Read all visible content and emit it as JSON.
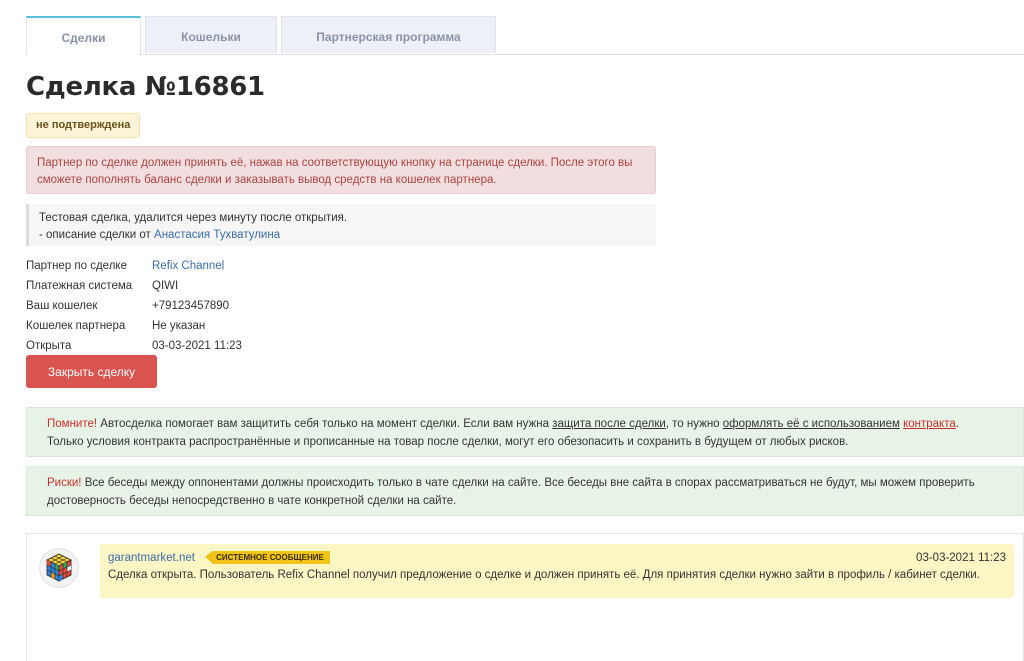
{
  "tabs": [
    {
      "label": "Сделки"
    },
    {
      "label": "Кошельки"
    },
    {
      "label": "Партнерская программа"
    }
  ],
  "deal": {
    "title": "Сделка №16861",
    "status": "не подтверждена"
  },
  "alert_partner": "Партнер по сделке должен принять её, нажав на соответствующую кнопку на странице сделки. После этого вы сможете пополнять баланс сделки и заказывать вывод средств на кошелек партнера.",
  "description": {
    "text": "Тестовая сделка, удалится через минуту после открытия.",
    "author_prefix": "- описание сделки от",
    "author": "Анастасия Тухватулина"
  },
  "info": [
    {
      "label": "Партнер по сделке",
      "value": "Refix Channel"
    },
    {
      "label": "Платежная система",
      "value": "QIWI"
    },
    {
      "label": "Ваш кошелек",
      "value": "+79123457890"
    },
    {
      "label": "Кошелек партнера",
      "value": "Не указан"
    },
    {
      "label": "Открыта",
      "value": "03-03-2021 11:23"
    }
  ],
  "close_button": "Закрыть сделку",
  "remember": {
    "lead": "Помните!",
    "t1": " Автосделка помогает вам защитить себя только на момент сделки. Если вам нужна ",
    "link1": "защита после сделки",
    "t2": ", то нужно ",
    "link2": "оформлять её с использованием",
    "t3": " ",
    "link3": "контракта",
    "t4": ".",
    "line2": "Только условия контракта распространённые и прописанные на товар после сделки, могут его обезопасить и сохранить в будущем от любых рисков."
  },
  "risks": {
    "lead": "Риски!",
    "text": " Все беседы между оппонентами должны происходить только в чате сделки на сайте. Все беседы вне сайта в спорах рассматриваться не будут, мы можем проверить достоверность беседы непосредственно в чате конкретной сделки на сайте."
  },
  "chat": {
    "sender": "garantmarket.net",
    "badge": "СИСТЕМНОЕ СООБЩЕНИЕ",
    "time": "03-03-2021 11:23",
    "text": "Сделка открыта. Пользователь Refix Channel получил предложение о сделке и должен принять её. Для принятия сделки нужно зайти в профиль / кабинет сделки."
  },
  "colors": {
    "danger": "#d9534f",
    "link": "#3a6ea8",
    "tab_accent": "#5bc0de",
    "badge_yellow": "#f0c419"
  }
}
